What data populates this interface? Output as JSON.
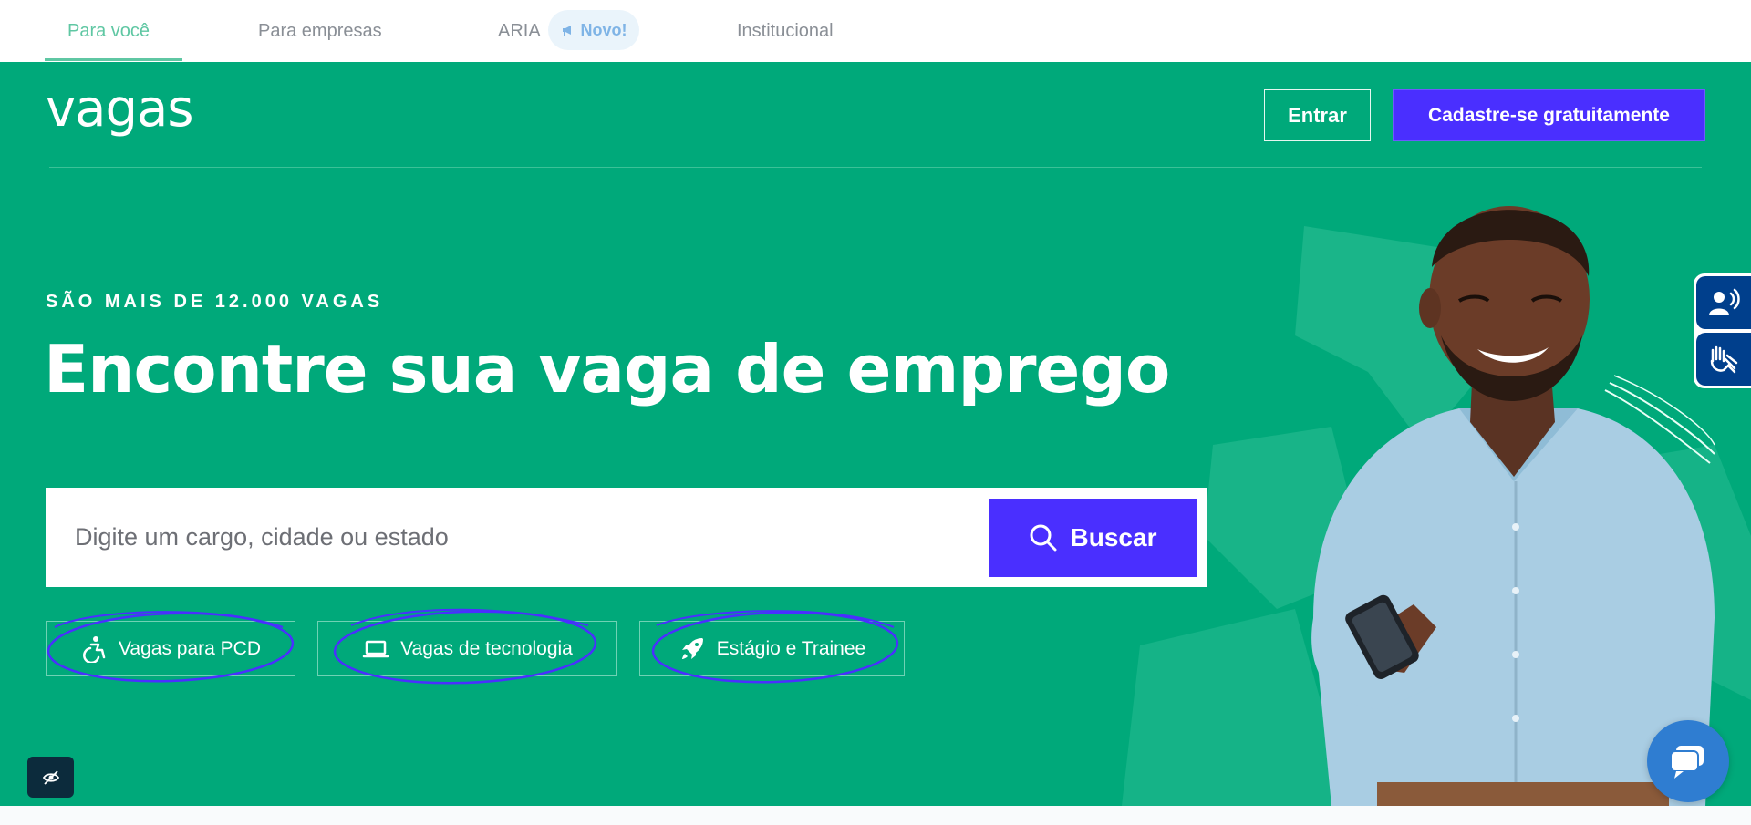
{
  "topnav": {
    "tabs": [
      {
        "label": "Para você",
        "active": true
      },
      {
        "label": "Para empresas",
        "active": false
      },
      {
        "label": "ARIA",
        "active": false
      },
      {
        "label": "Institucional",
        "active": false
      }
    ],
    "badge": {
      "label": "Novo!",
      "icon": "megaphone-icon"
    }
  },
  "header": {
    "logo": "vagas",
    "login_label": "Entrar",
    "signup_label": "Cadastre-se gratuitamente"
  },
  "hero": {
    "eyebrow": "SÃO MAIS DE 12.000 VAGAS",
    "headline": "Encontre sua vaga de emprego"
  },
  "search": {
    "placeholder": "Digite um cargo, cidade ou estado",
    "value": "",
    "button_label": "Buscar",
    "button_icon": "search-icon"
  },
  "quick_links": [
    {
      "label": "Vagas para PCD",
      "icon": "wheelchair-icon"
    },
    {
      "label": "Vagas de tecnologia",
      "icon": "laptop-icon"
    },
    {
      "label": "Estágio e Trainee",
      "icon": "rocket-icon"
    }
  ],
  "accessibility": {
    "items": [
      "voice-reader-icon",
      "sign-language-icon"
    ]
  },
  "colors": {
    "brand_green": "#00a97a",
    "accent_purple": "#4a2fff",
    "active_tab": "#5fc7a3",
    "accessibility_blue": "#003f8c",
    "chat_blue": "#2f7dd1"
  }
}
